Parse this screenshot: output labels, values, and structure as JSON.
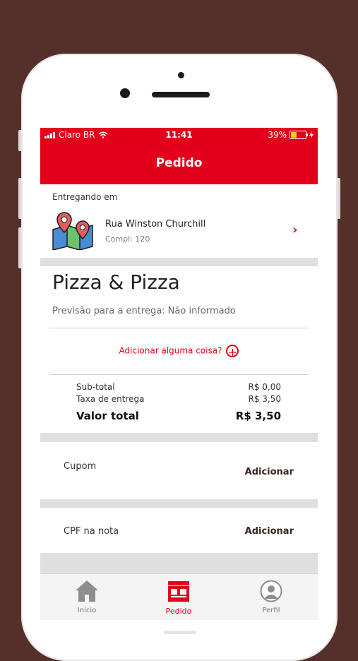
{
  "status_bar": {
    "carrier": "Claro BR",
    "time": "11:41",
    "battery": "39%",
    "battery_level": 0.39,
    "battery_color": "#f5d000"
  },
  "header": {
    "title": "Pedido"
  },
  "delivery": {
    "label": "Entregando em",
    "street": "Rua Winston Churchill",
    "complement": "Compl: 120",
    "icon": "map-pins-icon"
  },
  "store": {
    "name": "Pizza & Pizza",
    "eta": "Previsão para a entrega: Não informado",
    "add_item": "Adicionar alguma coisa?"
  },
  "summary": {
    "subtotal_label": "Sub-total",
    "subtotal_value": "R$ 0,00",
    "delivery_fee_label": "Taxa de entrega",
    "delivery_fee_value": "R$ 3,50",
    "total_label": "Valor total",
    "total_value": "R$ 3,50"
  },
  "options": [
    {
      "label": "Cupom",
      "action": "Adicionar"
    },
    {
      "label": "CPF na nota",
      "action": "Adicionar"
    }
  ],
  "tabs": [
    {
      "label": "Início",
      "icon": "home-icon",
      "active": false
    },
    {
      "label": "Pedido",
      "icon": "storefront-icon",
      "active": true
    },
    {
      "label": "Perfil",
      "icon": "user-icon",
      "active": false
    }
  ],
  "colors": {
    "brand_red": "#e3001b",
    "background": "#55302a",
    "action_text": "#3b2420"
  }
}
